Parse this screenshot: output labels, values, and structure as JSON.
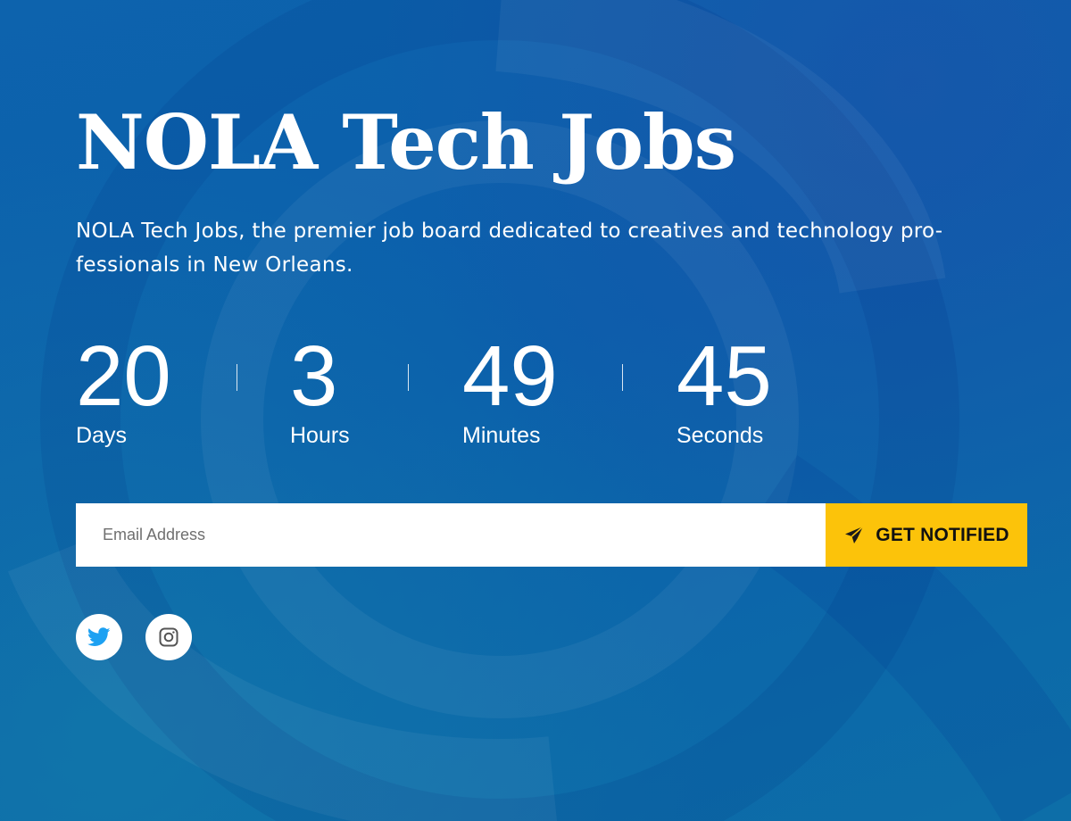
{
  "hero": {
    "title": "NOLA Tech Jobs",
    "description": "NOLA Tech Jobs, the premier job board dedicated to creatives and technology pro-fessionals in New Orleans."
  },
  "countdown": {
    "days": {
      "value": "20",
      "label": "Days"
    },
    "hours": {
      "value": "3",
      "label": "Hours"
    },
    "minutes": {
      "value": "49",
      "label": "Minutes"
    },
    "seconds": {
      "value": "45",
      "label": "Seconds"
    }
  },
  "signup": {
    "email_placeholder": "Email Address",
    "email_value": "",
    "button_label": "GET NOTIFIED",
    "button_icon": "paper-plane-icon"
  },
  "social": {
    "items": [
      {
        "name": "twitter",
        "icon": "twitter-icon",
        "color": "#1da1f2"
      },
      {
        "name": "instagram",
        "icon": "instagram-icon",
        "color": "#555555"
      }
    ]
  },
  "colors": {
    "background": "#0c63aa",
    "accent": "#fcc30a",
    "text": "#ffffff"
  }
}
